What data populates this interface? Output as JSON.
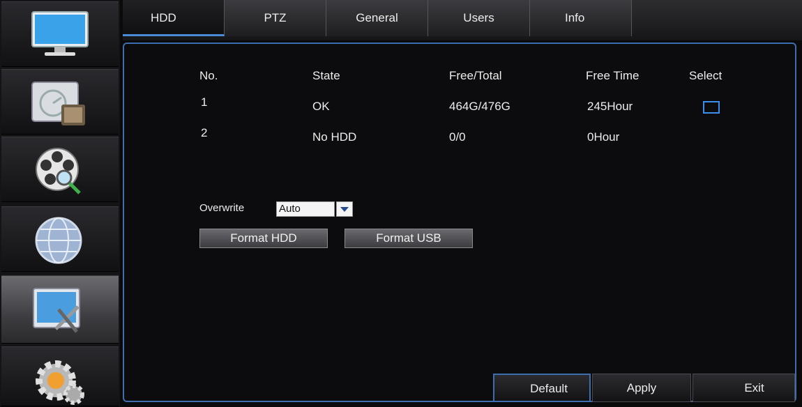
{
  "sidebar": {
    "items": [
      {
        "name": "display-icon"
      },
      {
        "name": "record-icon"
      },
      {
        "name": "playback-icon"
      },
      {
        "name": "network-icon"
      },
      {
        "name": "device-icon",
        "active": true
      },
      {
        "name": "system-gear-icon"
      }
    ]
  },
  "tabs": [
    "HDD",
    "PTZ",
    "General",
    "Users",
    "Info"
  ],
  "active_tab": "HDD",
  "hdd_table": {
    "headers": {
      "no": "No.",
      "state": "State",
      "free_total": "Free/Total",
      "free_time": "Free Time",
      "select": "Select"
    },
    "rows": [
      {
        "no": "1",
        "state": "OK",
        "free_total": "464G/476G",
        "free_time": "245Hour",
        "has_checkbox": true
      },
      {
        "no": "2",
        "state": "No HDD",
        "free_total": "0/0",
        "free_time": "0Hour",
        "has_checkbox": false
      }
    ]
  },
  "overwrite": {
    "label": "Overwrite",
    "value": "Auto"
  },
  "buttons": {
    "format_hdd": "Format HDD",
    "format_usb": "Format USB"
  },
  "footer": {
    "default": "Default",
    "apply": "Apply",
    "exit": "Exit"
  },
  "colors": {
    "accent": "#3d6fb0",
    "checkbox": "#3a8ef0"
  }
}
